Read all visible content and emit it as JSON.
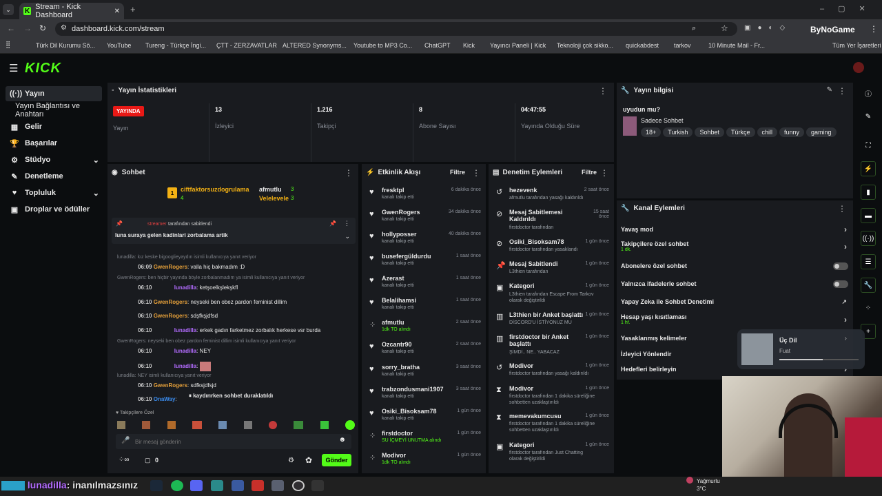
{
  "browser": {
    "tab_title": "Stream - Kick Dashboard",
    "url": "dashboard.kick.com/stream",
    "profile_label": "ByNoGame",
    "bookmarks": [
      "Türk Dil Kurumu Sö...",
      "YouTube",
      "Tureng - Türkçe İngi...",
      "ÇTT - ZERZAVATLAR",
      "ALTERED Synonyms...",
      "Youtube to MP3 Co...",
      "ChatGPT",
      "Kick",
      "Yayıncı Paneli | Kick",
      "Teknoloji çok sikko...",
      "quickabdest",
      "tarkov",
      "10 Minute Mail - Fr..."
    ],
    "all_bookmarks": "Tüm Yer İşaretleri"
  },
  "logo": "KICK",
  "sidebar": {
    "items": [
      {
        "label": "Yayın",
        "icon": "broadcast-icon"
      },
      {
        "label": "Yayın Bağlantısı ve Anahtarı",
        "icon": ""
      },
      {
        "label": "Gelir",
        "icon": "revenue-icon"
      },
      {
        "label": "Başarılar",
        "icon": "trophy-icon"
      },
      {
        "label": "Stüdyo",
        "icon": "studio-icon"
      },
      {
        "label": "Denetleme",
        "icon": "moderation-icon"
      },
      {
        "label": "Topluluk",
        "icon": "community-icon"
      },
      {
        "label": "Droplar ve ödüller",
        "icon": "drops-icon"
      }
    ]
  },
  "stats": {
    "title": "Yayın İstatistikleri",
    "live_badge": "YAYINDA",
    "items": [
      {
        "value": "",
        "label": "Yayın"
      },
      {
        "value": "13",
        "label": "İzleyici"
      },
      {
        "value": "1.216",
        "label": "Takipçi"
      },
      {
        "value": "8",
        "label": "Abone Sayısı"
      },
      {
        "value": "04:47:55",
        "label": "Yayında Olduğu Süre"
      }
    ]
  },
  "info": {
    "title": "Yayın bilgisi",
    "stream_title": "uyudun mu?",
    "category": "Sadece Sohbet",
    "tags": [
      "18+",
      "Turkish",
      "Sohbet",
      "Türkçe",
      "chill",
      "funny",
      "gaming"
    ]
  },
  "chat": {
    "title": "Sohbet",
    "top_gifter": "ciftfaktorsuzdogrulama",
    "top_gifter_count": "4",
    "second": "afmutlu",
    "second_count": "3",
    "third": "Velelevele",
    "third_count": "3",
    "pinned_by": "tarafından sabitlendi",
    "pinned_user": "streamer",
    "pinned_text": "luna suraya gelen kadinlari zorbalama artik",
    "lines": [
      {
        "reply": "lunadilla: kız keske bigooglieyaydın isimli kullanıcıya yanıt veriyor",
        "time": "06:09",
        "user": "GwenRogers",
        "color": "#e5a03a",
        "text": ": valla hiç bakmadım :D"
      },
      {
        "reply": "GwenRogers: ben hiçbir yayında böyle zorbalanmadım ya isimli kullanıcıya yanıt veriyor",
        "time": "06:10",
        "user": "lunadilla",
        "color": "#b36cff",
        "text": ": ketşoelkşlekşkfl"
      },
      {
        "reply": "",
        "time": "06:10",
        "user": "GwenRogers",
        "color": "#e5a03a",
        "text": ": neyseki ben obez pardon feminist dillim"
      },
      {
        "reply": "",
        "time": "06:10",
        "user": "GwenRogers",
        "color": "#e5a03a",
        "text": ": sdşfkşjdfsd"
      },
      {
        "reply": "",
        "time": "06:10",
        "user": "lunadilla",
        "color": "#b36cff",
        "text": ": erkek gadın farketmez zorbalık herkese vsr burda"
      },
      {
        "reply": "GwenRogers: neyseki ben obez pardon feminist dillim isimli kullanıcıya yanıt veriyor",
        "time": "06:10",
        "user": "lunadilla",
        "color": "#b36cff",
        "text": ": NEY"
      },
      {
        "reply": "",
        "time": "06:10",
        "user": "lunadilla",
        "color": "#b36cff",
        "text": ":"
      },
      {
        "reply": "lunadilla: NEY isimli kullanıcıya yanıt veriyor",
        "time": "06:10",
        "user": "GwenRogers",
        "color": "#e5a03a",
        "text": ": sdfksjdfsjd"
      },
      {
        "reply": "",
        "time": "06:10",
        "user": "OnaWay",
        "color": "#3a8df0",
        "text": ":"
      }
    ],
    "paused": "kaydırırken sohbet duraklatıldı",
    "followers_only": "Takipçilere Özel",
    "input_placeholder": "Bir mesaj gönderin",
    "count": "0",
    "send": "Gönder"
  },
  "activity": {
    "title": "Etkinlik Akışı",
    "filter": "Filtre",
    "items": [
      {
        "name": "fresktpl",
        "sub": "kanalı takip etti",
        "time": "6 dakika önce",
        "icon": "heart-icon"
      },
      {
        "name": "GwenRogers",
        "sub": "kanalı takip etti",
        "time": "34 dakika önce",
        "icon": "heart-icon"
      },
      {
        "name": "hollyposser",
        "sub": "kanalı takip etti",
        "time": "40 dakika önce",
        "icon": "heart-icon"
      },
      {
        "name": "busefergüldurdu",
        "sub": "kanalı takip etti",
        "time": "1 saat önce",
        "icon": "heart-icon"
      },
      {
        "name": "Azerast",
        "sub": "kanalı takip etti",
        "time": "1 saat önce",
        "icon": "heart-icon"
      },
      {
        "name": "Belalihamsi",
        "sub": "kanalı takip etti",
        "time": "1 saat önce",
        "icon": "heart-icon"
      },
      {
        "name": "afmutlu",
        "sub": "1dk TO alındı",
        "time": "2 saat önce",
        "icon": "timeout-icon"
      },
      {
        "name": "Ozcantr90",
        "sub": "kanalı takip etti",
        "time": "2 saat önce",
        "icon": "heart-icon"
      },
      {
        "name": "sorry_bratha",
        "sub": "kanalı takip etti",
        "time": "3 saat önce",
        "icon": "heart-icon"
      },
      {
        "name": "trabzondusmani1907",
        "sub": "kanalı takip etti",
        "time": "3 saat önce",
        "icon": "heart-icon"
      },
      {
        "name": "Osiki_Bisoksam78",
        "sub": "kanalı takip etti",
        "time": "1 gün önce",
        "icon": "heart-icon"
      },
      {
        "name": "firstdoctor",
        "sub": "SU İÇMEYİ UNUTMA alındı",
        "time": "1 gün önce",
        "icon": "timeout-icon"
      },
      {
        "name": "Modivor",
        "sub": "1dk TO alındı",
        "time": "1 gün önce",
        "icon": "timeout-icon"
      }
    ]
  },
  "modlog": {
    "title": "Denetim Eylemleri",
    "filter": "Filtre",
    "items": [
      {
        "name": "hezevenk",
        "sub": "afmutlu tarafından yasağı kaldırıldı",
        "time": "2 saat önce",
        "icon": "undo-icon"
      },
      {
        "name": "Mesaj Sabitlemesi Kaldırıldı",
        "sub": "firstdoctor tarafından",
        "time": "15 saat önce",
        "icon": "unpin-icon"
      },
      {
        "name": "Osiki_Bisoksam78",
        "sub": "firstdoctor tarafından yasaklandı",
        "time": "1 gün önce",
        "icon": "ban-icon"
      },
      {
        "name": "Mesaj Sabitlendi",
        "sub": "L3thien tarafından",
        "time": "1 gün önce",
        "icon": "pin-icon"
      },
      {
        "name": "Kategori",
        "sub": "L3thien tarafından Escape From Tarkov olarak değiştirildi",
        "time": "1 gün önce",
        "icon": "category-icon"
      },
      {
        "name": "L3thien bir Anket başlattı",
        "sub": "DİSCORD'U İSTİYONUZ MU",
        "time": "1 gün önce",
        "icon": "poll-icon"
      },
      {
        "name": "firstdoctor bir Anket başlattı",
        "sub": "ŞİMDİ.. NE.. YABACAZ",
        "time": "1 gün önce",
        "icon": "poll-icon"
      },
      {
        "name": "Modivor",
        "sub": "firstdoctor tarafından yasağı kaldırıldı",
        "time": "1 gün önce",
        "icon": "undo-icon"
      },
      {
        "name": "Modivor",
        "sub": "firstdoctor tarafından 1 dakika süreliğine sohbetten uzaklaştırıldı",
        "time": "1 gün önce",
        "icon": "hourglass-icon"
      },
      {
        "name": "memevakumcusu",
        "sub": "firstdoctor tarafından 1 dakika süreliğine sohbetten uzaklaştırıldı",
        "time": "1 gün önce",
        "icon": "hourglass-icon"
      },
      {
        "name": "Kategori",
        "sub": "firstdoctor tarafından Just Chatting olarak değiştirildi",
        "time": "1 gün önce",
        "icon": "category-icon"
      }
    ]
  },
  "channel": {
    "title": "Kanal Eylemleri",
    "items": [
      {
        "label": "Yavaş mod",
        "sub": "",
        "ctrl": "chevron"
      },
      {
        "label": "Takipçilere özel sohbet",
        "sub": "1 dk.",
        "ctrl": "chevron"
      },
      {
        "label": "Abonelere özel sohbet",
        "sub": "",
        "ctrl": "toggle"
      },
      {
        "label": "Yalnızca ifadelerle sohbet",
        "sub": "",
        "ctrl": "toggle"
      },
      {
        "label": "Yapay Zeka ile Sohbet Denetimi",
        "sub": "",
        "ctrl": "external"
      },
      {
        "label": "Hesap yaşı kısıtlaması",
        "sub": "1 hf.",
        "ctrl": "chevron"
      },
      {
        "label": "Yasaklanmış kelimeler",
        "sub": "",
        "ctrl": ""
      },
      {
        "label": "İzleyici Yönlendir",
        "sub": "",
        "ctrl": ""
      },
      {
        "label": "Hedefleri belirleyin",
        "sub": "",
        "ctrl": ""
      }
    ]
  },
  "music": {
    "title": "Üç Dil",
    "artist": "Fuat"
  },
  "overlay": {
    "user": "lunadilla",
    "text": ": inanılmazsınız"
  },
  "weather": {
    "label": "Yağmurlu",
    "temp": "3°C"
  },
  "colors": {
    "accent": "#53fc18",
    "live": "#e91916",
    "panel": "#191b1f"
  }
}
